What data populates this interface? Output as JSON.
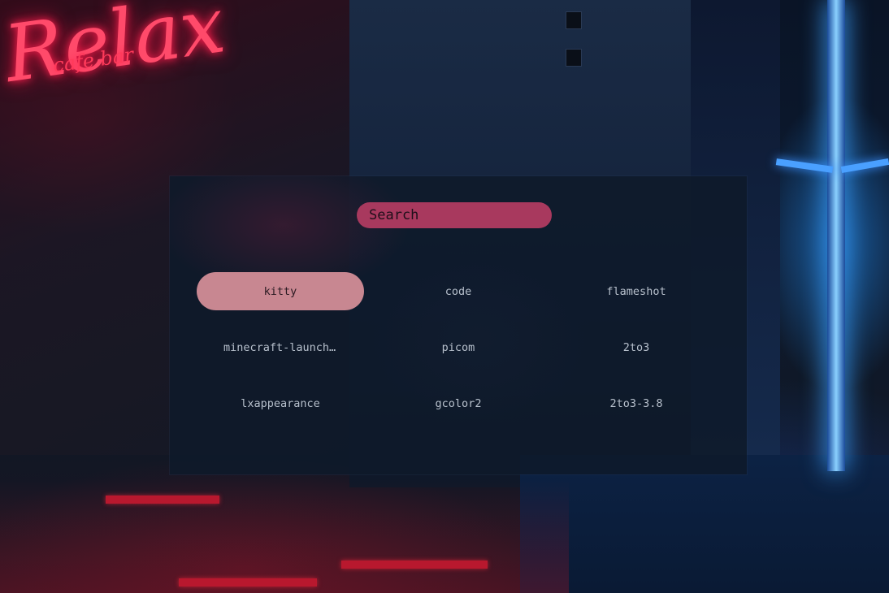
{
  "wallpaper": {
    "sign_text": "Relax",
    "sign_small_text": "cafe bar"
  },
  "launcher": {
    "search": {
      "placeholder": "Search",
      "value": ""
    },
    "apps": [
      {
        "label": "kitty",
        "selected": true
      },
      {
        "label": "code",
        "selected": false
      },
      {
        "label": "flameshot",
        "selected": false
      },
      {
        "label": "minecraft-launcher",
        "selected": false
      },
      {
        "label": "picom",
        "selected": false
      },
      {
        "label": "2to3",
        "selected": false
      },
      {
        "label": "lxappearance",
        "selected": false
      },
      {
        "label": "gcolor2",
        "selected": false
      },
      {
        "label": "2to3-3.8",
        "selected": false
      }
    ]
  },
  "colors": {
    "launcher_bg": "#0e1a2a",
    "search_bg": "#a8395e",
    "selected_bg": "#c88791",
    "item_text": "#b7c0cc"
  }
}
